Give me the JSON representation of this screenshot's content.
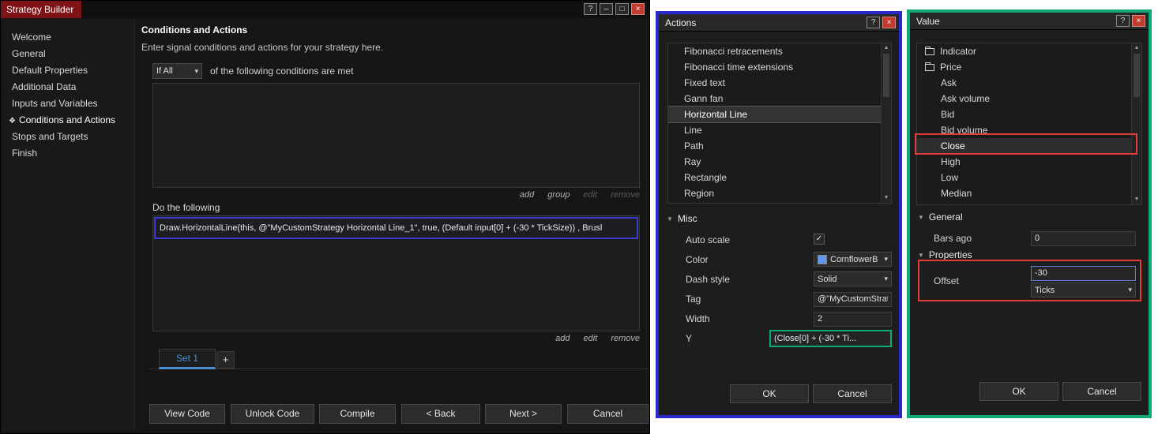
{
  "icons": {
    "help": "?",
    "minimize": "–",
    "maximize": "□",
    "close": "×",
    "chevron_down": "▾",
    "check": "✓",
    "expander_open": "▼",
    "scroll_up": "▲",
    "scroll_down": "▼",
    "diamond": "❖",
    "add_tab": "+"
  },
  "colors": {
    "titlebar_red": "#7e1416",
    "accent_blue": "#4a8fd4",
    "cornflower_blue": "#6495ED",
    "annotation_blue": "#2929cc",
    "annotation_green": "#10a97a",
    "annotation_red": "#e23d3d"
  },
  "main_window": {
    "title": "Strategy Builder",
    "sidebar": {
      "items": [
        {
          "label": "Welcome"
        },
        {
          "label": "General"
        },
        {
          "label": "Default Properties"
        },
        {
          "label": "Additional Data"
        },
        {
          "label": "Inputs and Variables"
        },
        {
          "label": "Conditions and Actions"
        },
        {
          "label": "Stops and Targets"
        },
        {
          "label": "Finish"
        }
      ]
    },
    "content": {
      "heading": "Conditions and Actions",
      "subheading": "Enter signal conditions and actions for your strategy here.",
      "if_dropdown_value": "If All",
      "conditions_suffix": "of the following conditions are met",
      "condition_links": [
        "add",
        "group",
        "edit",
        "remove"
      ],
      "do_following_label": "Do the following",
      "action_code": "Draw.HorizontalLine(this, @\"MyCustomStrategy Horizontal Line_1\", true, (Default input[0] + (-30 * TickSize)) , Brusl",
      "action_links": [
        "add",
        "edit",
        "remove"
      ],
      "set_tab_label": "Set 1",
      "footer_buttons": [
        "View Code",
        "Unlock Code",
        "Compile",
        "< Back",
        "Next >",
        "Cancel"
      ]
    }
  },
  "actions_dialog": {
    "title": "Actions",
    "list_items": [
      "Fibonacci retracements",
      "Fibonacci time extensions",
      "Fixed text",
      "Gann fan",
      "Horizontal Line",
      "Line",
      "Path",
      "Ray",
      "Rectangle",
      "Region"
    ],
    "misc_section_label": "Misc",
    "props": {
      "auto_scale_label": "Auto scale",
      "color_label": "Color",
      "color_value": "CornflowerB",
      "dash_label": "Dash style",
      "dash_value": "Solid",
      "tag_label": "Tag",
      "tag_value": "@\"MyCustomStrat...",
      "width_label": "Width",
      "width_value": "2",
      "y_label": "Y",
      "y_value": "(Close[0] + (-30 * Ti..."
    },
    "ok_label": "OK",
    "cancel_label": "Cancel"
  },
  "value_dialog": {
    "title": "Value",
    "tree_items": [
      {
        "label": "Indicator"
      },
      {
        "label": "Price"
      },
      {
        "label": "Ask"
      },
      {
        "label": "Ask volume"
      },
      {
        "label": "Bid"
      },
      {
        "label": "Bid volume"
      },
      {
        "label": "Close"
      },
      {
        "label": "High"
      },
      {
        "label": "Low"
      },
      {
        "label": "Median"
      }
    ],
    "general_section_label": "General",
    "bars_ago_label": "Bars ago",
    "bars_ago_value": "0",
    "properties_section_label": "Properties",
    "offset_label": "Offset",
    "offset_value": "-30",
    "offset_unit_value": "Ticks",
    "ok_label": "OK",
    "cancel_label": "Cancel"
  }
}
